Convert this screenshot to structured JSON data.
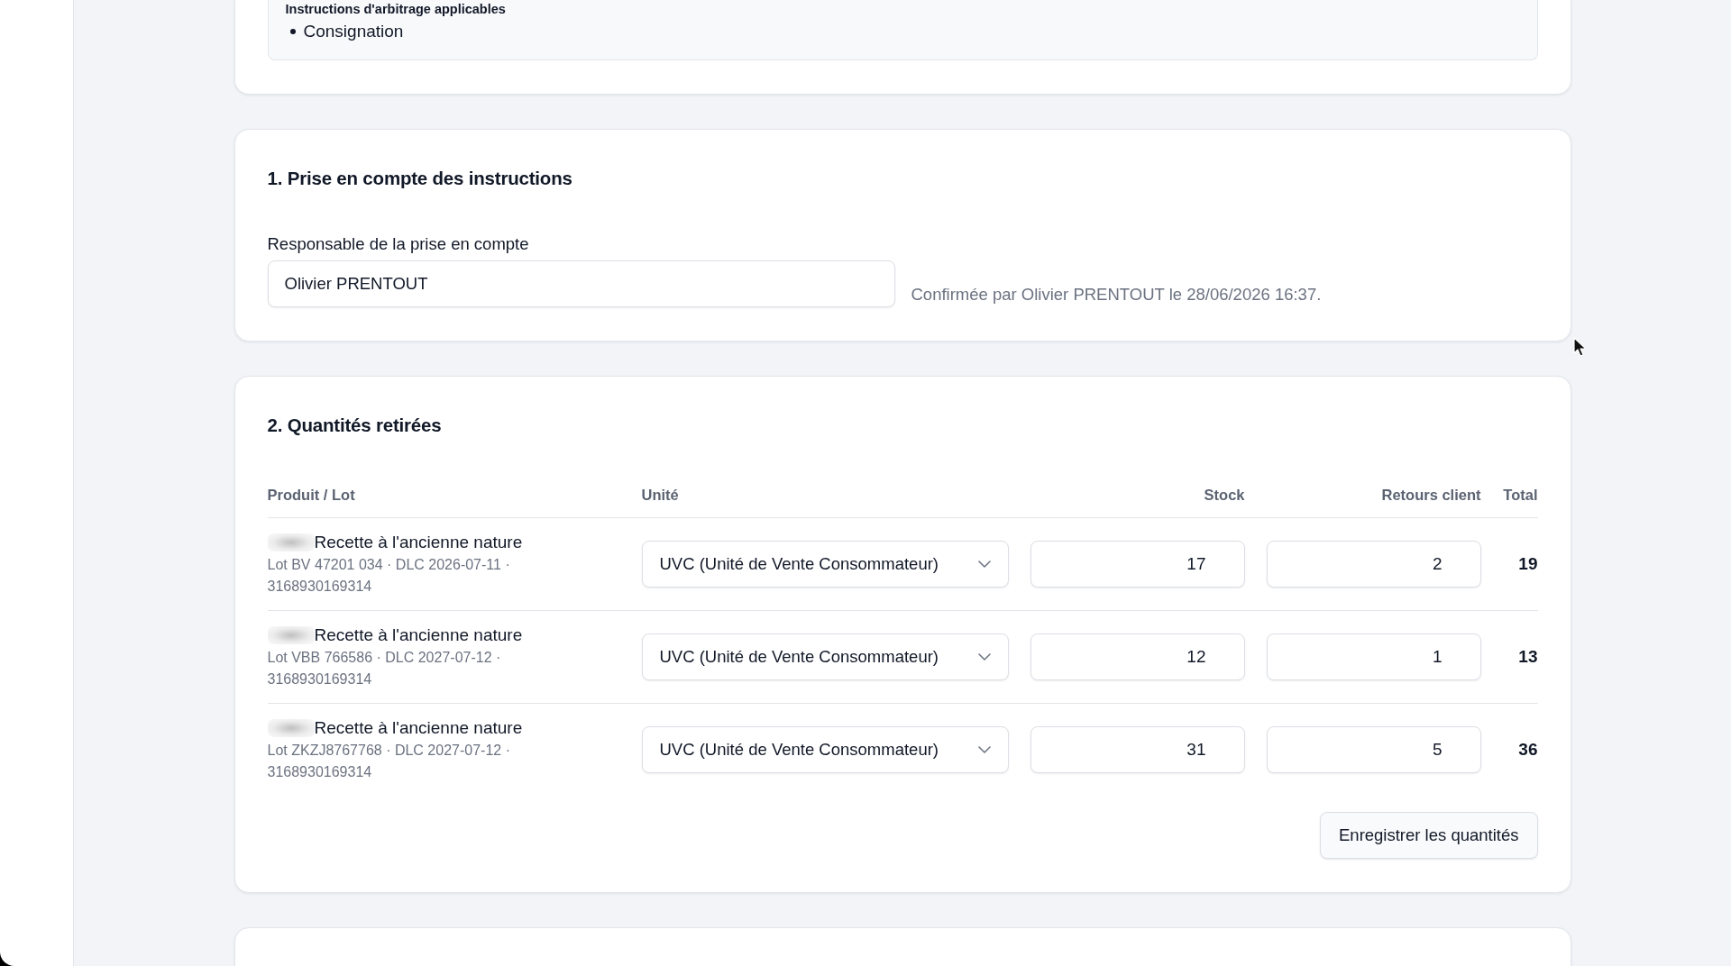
{
  "instructions_card": {
    "label": "Instructions d'arbitrage applicables",
    "items": [
      "Consignation"
    ]
  },
  "acknowledgement": {
    "title": "1. Prise en compte des instructions",
    "field": {
      "label": "Responsable de la prise en compte",
      "value": "Olivier PRENTOUT"
    },
    "confirmation": "Confirmée par Olivier PRENTOUT le 28/06/2026 16:37."
  },
  "quantities": {
    "title": "2. Quantités retirées",
    "columns": [
      "Produit / Lot",
      "Unité",
      "Stock",
      "Retours client",
      "Total"
    ],
    "rows": [
      {
        "product": "Recette à l'ancienne nature",
        "details": "Lot BV 47201 034 · DLC 2026-07-11 · 3168930169314",
        "unit": "UVC (Unité de Vente Consommateur)",
        "stock": "17",
        "returns": "2",
        "total": "19"
      },
      {
        "product": "Recette à l'ancienne nature",
        "details": "Lot VBB 766586 · DLC 2027-07-12 · 3168930169314",
        "unit": "UVC (Unité de Vente Consommateur)",
        "stock": "12",
        "returns": "1",
        "total": "13"
      },
      {
        "product": "Recette à l'ancienne nature",
        "details": "Lot ZKZJ8767768 · DLC 2027-07-12 · 3168930169314",
        "unit": "UVC (Unité de Vente Consommateur)",
        "stock": "31",
        "returns": "5",
        "total": "36"
      }
    ],
    "save_button": "Enregistrer les quantités"
  }
}
